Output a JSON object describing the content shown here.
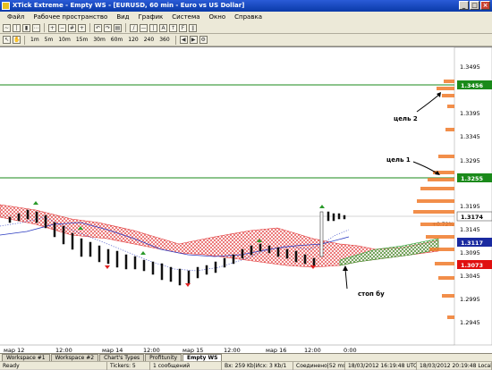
{
  "window": {
    "title": "XTick Extreme - Empty WS - [EURUSD, 60 min - Euro vs US Dollar]",
    "buttons": [
      "_",
      "□",
      "×"
    ]
  },
  "menu": [
    "Файл",
    "Рабочее пространство",
    "Вид",
    "График",
    "Система",
    "Окно",
    "Справка"
  ],
  "toolbar": {
    "timeframes": [
      "1m",
      "5m",
      "10m",
      "15m",
      "30m",
      "60m",
      "120",
      "240",
      "360"
    ]
  },
  "chart": {
    "price_labels": [
      "1.3495",
      "1.3395",
      "1.3345",
      "1.3295",
      "1.3195",
      "1.3145",
      "1.3095",
      "1.3045",
      "1.2995",
      "1.2945"
    ],
    "levels": {
      "target2": "1.3456",
      "target1": "1.3255",
      "current": "1.3174",
      "change": "+0.72%",
      "blue_level": "1.3117",
      "red_level": "1.3073"
    },
    "annotations": {
      "target2": "цель 2",
      "target1": "цель 1",
      "stop": "стоп бу"
    },
    "time_labels": [
      "мар 12",
      "12:00",
      "мар 14",
      "12:00",
      "мар 15",
      "12:00",
      "мар 16",
      "12:00",
      "0:00"
    ],
    "colors": {
      "target_line": "#1a8a1a",
      "target_label_bg": "#1a8a1a",
      "cloud_red": "#e03030",
      "cloud_green": "#2a9a2a",
      "current_label_bg": "#ffffff",
      "blue_label_bg": "#1a2aa0",
      "red_label_bg": "#e01010",
      "volume_profile": "#f07a2a"
    }
  },
  "tabs": [
    "Workspace #1",
    "Workspace #2",
    "Chart's Types",
    "Profitunity",
    "Empty WS"
  ],
  "active_tab": "Empty WS",
  "status": {
    "ready": "Ready",
    "tickers": "Tickers: 5",
    "messages": "1 сообщений",
    "traffic": "Bx: 259 Kb|Исх: 3 Kb/1",
    "connection": "Соединено|52 ms",
    "server_time": "18/03/2012 16:19:48 UTC",
    "local_time": "18/03/2012 20:19:48 Local"
  }
}
